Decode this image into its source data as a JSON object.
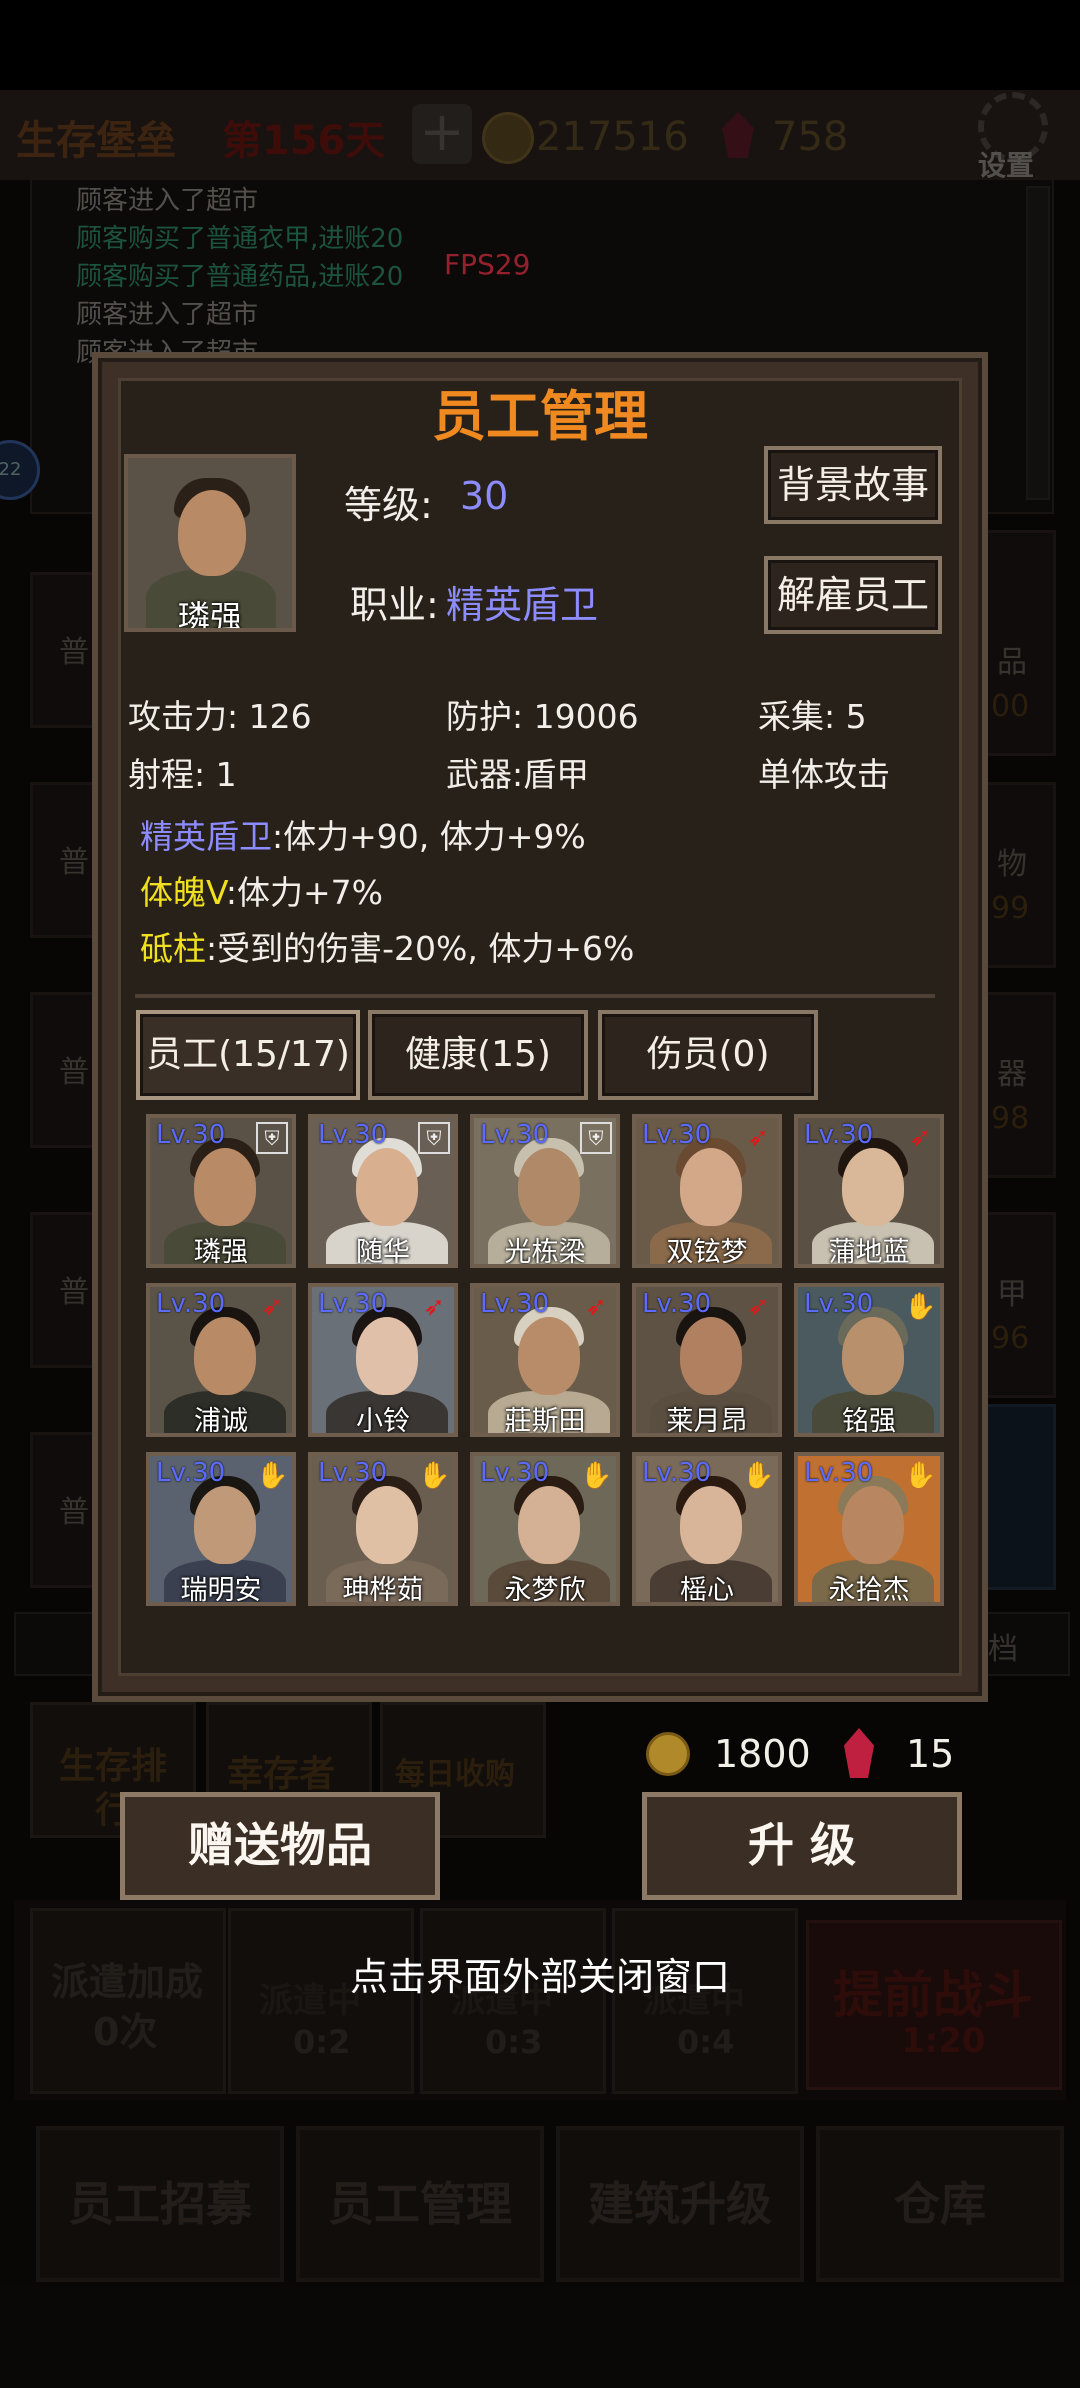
{
  "background": {
    "game_title": "生存堡垒",
    "day": "第156天",
    "coins": "217516",
    "gems": "758",
    "settings": "设置",
    "fps": "FPS29",
    "log": [
      {
        "text": "顾客进入了超市",
        "color": "#8f8a84"
      },
      {
        "text": "顾客购买了普通衣甲,进账20",
        "color": "#2f8f6a"
      },
      {
        "text": "顾客购买了普通药品,进账20",
        "color": "#2f8f6a"
      },
      {
        "text": "顾客进入了超市",
        "color": "#8f8a84"
      },
      {
        "text": "顾客进入了超市",
        "color": "#8f8a84"
      }
    ],
    "side_left": [
      "普",
      "普",
      "普",
      "普",
      "普"
    ],
    "side_right": [
      {
        "label": "品",
        "num": "00"
      },
      {
        "label": "物",
        "num": "99"
      },
      {
        "label": "器",
        "num": "98"
      },
      {
        "label": "甲",
        "num": "96"
      }
    ],
    "right_tab": "档",
    "bottom_tabs": [
      "生存排行",
      "幸存者",
      "每日收购"
    ],
    "dispatch": {
      "bonus_label": "派遣加成",
      "bonus_value": "0次",
      "slots": [
        {
          "label": "派遣中",
          "time": "0:2"
        },
        {
          "label": "派遣中",
          "time": "0:3"
        },
        {
          "label": "派遣中",
          "time": "0:4"
        }
      ],
      "battle_label": "提前战斗",
      "battle_time": "1:20"
    },
    "nav": [
      "员工招募",
      "员工管理",
      "建筑升级",
      "仓库"
    ]
  },
  "dialog": {
    "title": "员工管理",
    "selected": {
      "name": "璘强",
      "level_label": "等级:",
      "level": "30",
      "job_label": "职业:",
      "job": "精英盾卫"
    },
    "buttons": {
      "story": "背景故事",
      "fire": "解雇员工",
      "gift": "赠送物品",
      "upgrade": "升 级"
    },
    "stats": {
      "attack": "攻击力: 126",
      "defense": "防护: 19006",
      "gather": "采集: 5",
      "range": "射程: 1",
      "weapon": "武器:盾甲",
      "attack_type": "单体攻击"
    },
    "traits": [
      {
        "name": "精英盾卫",
        "name_color": "#8c8cff",
        "effect": ":体力+90, 体力+9%"
      },
      {
        "name": "体魄V",
        "name_color": "#f0e020",
        "effect": ":体力+7%"
      },
      {
        "name": "砥柱",
        "name_color": "#f0e020",
        "effect": ":受到的伤害-20%, 体力+6%"
      }
    ],
    "tabs": [
      "员工(15/17)",
      "健康(15)",
      "伤员(0)"
    ],
    "employees": [
      {
        "name": "璘强",
        "lv": "Lv.30",
        "badge": "shield",
        "skin": "#b88a66",
        "hair": "#2a2018",
        "cloth": "#4a4a38",
        "bg": "#5a5246"
      },
      {
        "name": "随华",
        "lv": "Lv.30",
        "badge": "shield",
        "skin": "#d8b090",
        "hair": "#e0ddd6",
        "cloth": "#d8d4cc",
        "bg": "#6a5f54"
      },
      {
        "name": "光栋梁",
        "lv": "Lv.30",
        "badge": "shield",
        "skin": "#b08a68",
        "hair": "#c8c0ae",
        "cloth": "#b6ae9a",
        "bg": "#7a7060"
      },
      {
        "name": "双铉梦",
        "lv": "Lv.30",
        "badge": "bow",
        "skin": "#d2a888",
        "hair": "#6a4a30",
        "cloth": "#8a6a4a",
        "bg": "#6a5a48"
      },
      {
        "name": "蒲地蓝",
        "lv": "Lv.30",
        "badge": "bow",
        "skin": "#d8b898",
        "hair": "#20160f",
        "cloth": "#c8c0b0",
        "bg": "#5a5044"
      },
      {
        "name": "浦诚",
        "lv": "Lv.30",
        "badge": "bow",
        "skin": "#b88a66",
        "hair": "#1a1410",
        "cloth": "#2e2e28",
        "bg": "#5a5448"
      },
      {
        "name": "小铃",
        "lv": "Lv.30",
        "badge": "bow",
        "skin": "#e0c0a8",
        "hair": "#1a1412",
        "cloth": "#3a3634",
        "bg": "#6a7078"
      },
      {
        "name": "莊斯田",
        "lv": "Lv.30",
        "badge": "bow",
        "skin": "#b88c68",
        "hair": "#d8d0c0",
        "cloth": "#b8aa92",
        "bg": "#6a5c4a"
      },
      {
        "name": "莱月昂",
        "lv": "Lv.30",
        "badge": "bow",
        "skin": "#b08060",
        "hair": "#1a1410",
        "cloth": "#5a4e40",
        "bg": "#5e5244"
      },
      {
        "name": "铭强",
        "lv": "Lv.30",
        "badge": "hand",
        "skin": "#b8906c",
        "hair": "#6a6a5a",
        "cloth": "#4a4a3a",
        "bg": "#4a5a5e"
      },
      {
        "name": "瑞明安",
        "lv": "Lv.30",
        "badge": "hand",
        "skin": "#c09a78",
        "hair": "#1a1612",
        "cloth": "#3a4050",
        "bg": "#5a6270"
      },
      {
        "name": "珅桦茹",
        "lv": "Lv.30",
        "badge": "hand",
        "skin": "#e0c0a4",
        "hair": "#2a1e16",
        "cloth": "#7a6a5a",
        "bg": "#6a5e50"
      },
      {
        "name": "永梦欣",
        "lv": "Lv.30",
        "badge": "hand",
        "skin": "#d4b094",
        "hair": "#2a1c12",
        "cloth": "#5a4a3a",
        "bg": "#6e6858"
      },
      {
        "name": "榣心",
        "lv": "Lv.30",
        "badge": "hand",
        "skin": "#d8b498",
        "hair": "#2a1a10",
        "cloth": "#4a3e34",
        "bg": "#7a6a5a"
      },
      {
        "name": "永拾杰",
        "lv": "Lv.30",
        "badge": "hand",
        "skin": "#b88660",
        "hair": "#8a7a5a",
        "cloth": "#7a6a4a",
        "bg": "#c07030"
      }
    ],
    "cost": {
      "coins": "1800",
      "gems": "15"
    },
    "close_hint": "点击界面外部关闭窗口"
  },
  "colors": {
    "title_orange": "#f08a20",
    "level_blue": "#8c8cff",
    "trait_yellow": "#f0e020",
    "lv_blue": "#5b6bff",
    "hand_green": "#22dd22",
    "bow_red": "#e01818"
  }
}
